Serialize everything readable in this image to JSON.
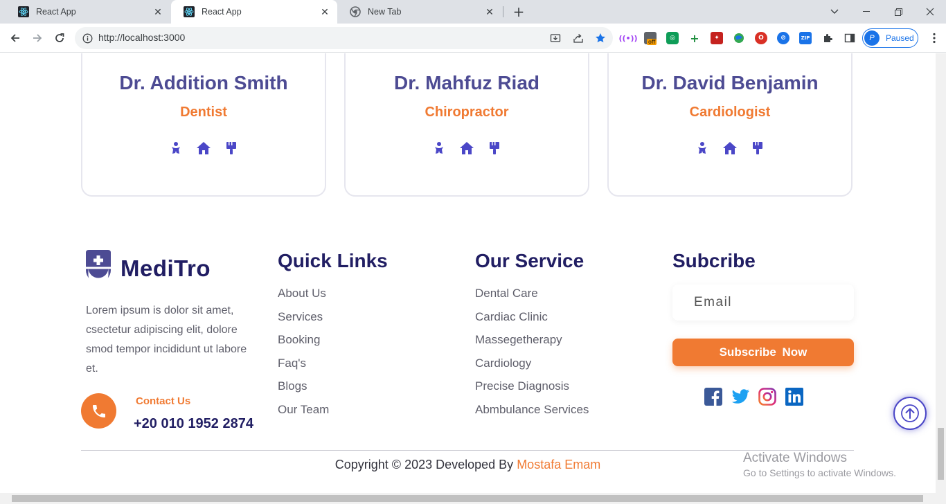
{
  "browser": {
    "tabs": [
      {
        "title": "React App",
        "active": false
      },
      {
        "title": "React App",
        "active": true
      },
      {
        "title": "New Tab",
        "active": false
      }
    ],
    "url": "http://localhost:3000",
    "extension_badge": "off",
    "profile_initial": "P",
    "profile_status": "Paused"
  },
  "doctors": [
    {
      "name": "Dr. Addition Smith",
      "specialty": "Dentist"
    },
    {
      "name": "Dr. Mahfuz Riad",
      "specialty": "Chiropractor"
    },
    {
      "name": "Dr. David Benjamin",
      "specialty": "Cardiologist"
    }
  ],
  "doctor_icons": [
    "baby-icon",
    "home-icon",
    "brush-icon"
  ],
  "footer": {
    "brand": "MediTro",
    "about": "Lorem ipsum is dolor sit amet, csectetur adipiscing elit, dolore smod tempor incididunt ut labore et.",
    "contact_label": "Contact Us",
    "contact_number": "+20 010 1952 2874",
    "quick_links": {
      "title": "Quick Links",
      "items": [
        "About Us",
        "Services",
        "Booking",
        "Faq's",
        "Blogs",
        "Our Team"
      ]
    },
    "services": {
      "title": "Our Service",
      "items": [
        "Dental Care",
        "Cardiac Clinic",
        "Massegetherapy",
        "Cardiology",
        "Precise Diagnosis",
        "Abmbulance Services"
      ]
    },
    "subscribe": {
      "title": "Subcribe",
      "email_placeholder": "Email",
      "button_label": "Subscribe  Now"
    },
    "socials": [
      "facebook-icon",
      "twitter-icon",
      "instagram-icon",
      "linkedin-icon"
    ],
    "copyright_prefix": "Copyright © 2023 Developed By ",
    "copyright_author": "Mostafa Emam"
  },
  "watermark": {
    "line1": "Activate Windows",
    "line2": "Go to Settings to activate Windows."
  },
  "colors": {
    "brand_navy": "#211e63",
    "doctor_name": "#4d4b93",
    "accent_orange": "#f07a32",
    "icon_indigo": "#4b47c7"
  }
}
